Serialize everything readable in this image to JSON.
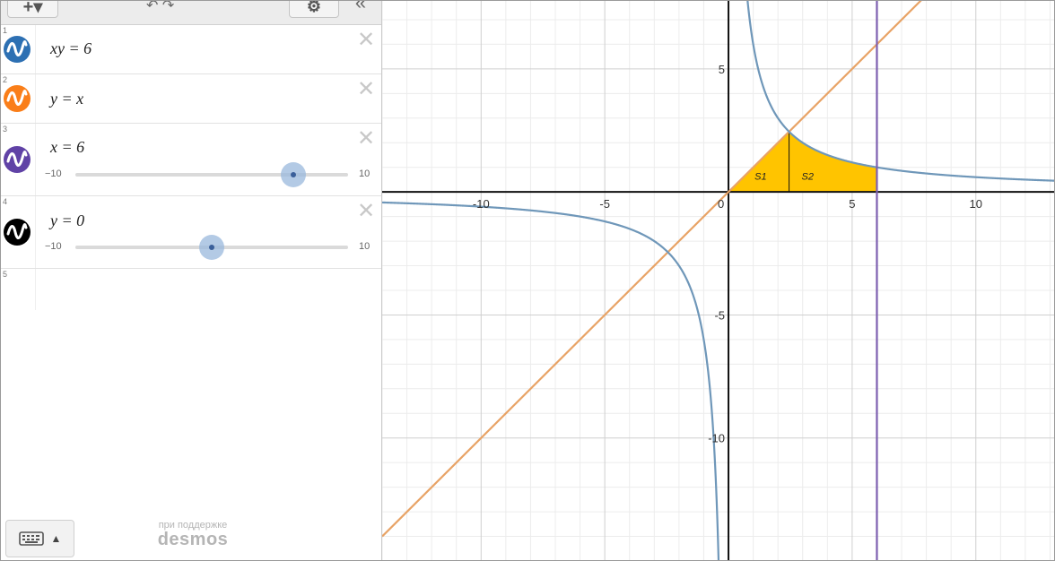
{
  "toolbar": {
    "add_symbol": "+▾",
    "undo_redo_symbol": "↶ ↷",
    "settings_symbol": "⚙",
    "collapse_symbol": "«"
  },
  "expressions": [
    {
      "num": "1",
      "latex": "xy = 6",
      "color": "#2d70b3",
      "icon": "wave-icon"
    },
    {
      "num": "2",
      "latex": "y = x",
      "color": "#fa7e19",
      "icon": "wave-icon"
    },
    {
      "num": "3",
      "latex": "x = 6",
      "color": "#6042a6",
      "icon": "wave-icon",
      "slider": {
        "min": "−10",
        "max": "10",
        "value": 6
      }
    },
    {
      "num": "4",
      "latex": "y = 0",
      "color": "#000000",
      "icon": "wave-icon",
      "slider": {
        "min": "−10",
        "max": "10",
        "value": 0
      }
    },
    {
      "num": "5"
    }
  ],
  "delete_symbol": "✕",
  "keyboard": {
    "icon": "keyboard-icon",
    "arrow_symbol": "▲"
  },
  "powered_by": {
    "text": "при поддержке",
    "brand": "desmos"
  },
  "graph": {
    "x_range": [
      -14,
      13.2
    ],
    "y_range": [
      -15,
      7.8
    ],
    "x_tick_labels": [
      "-10",
      "-5",
      "0",
      "5",
      "10"
    ],
    "y_tick_labels": [
      "5",
      "-5",
      "-10"
    ],
    "region_labels": [
      "S1",
      "S2"
    ],
    "colors": {
      "hyperbola": "#6f97b9",
      "line": "#e8a366",
      "vertical": "#7d5fb0",
      "fill": "#ffc400"
    }
  }
}
